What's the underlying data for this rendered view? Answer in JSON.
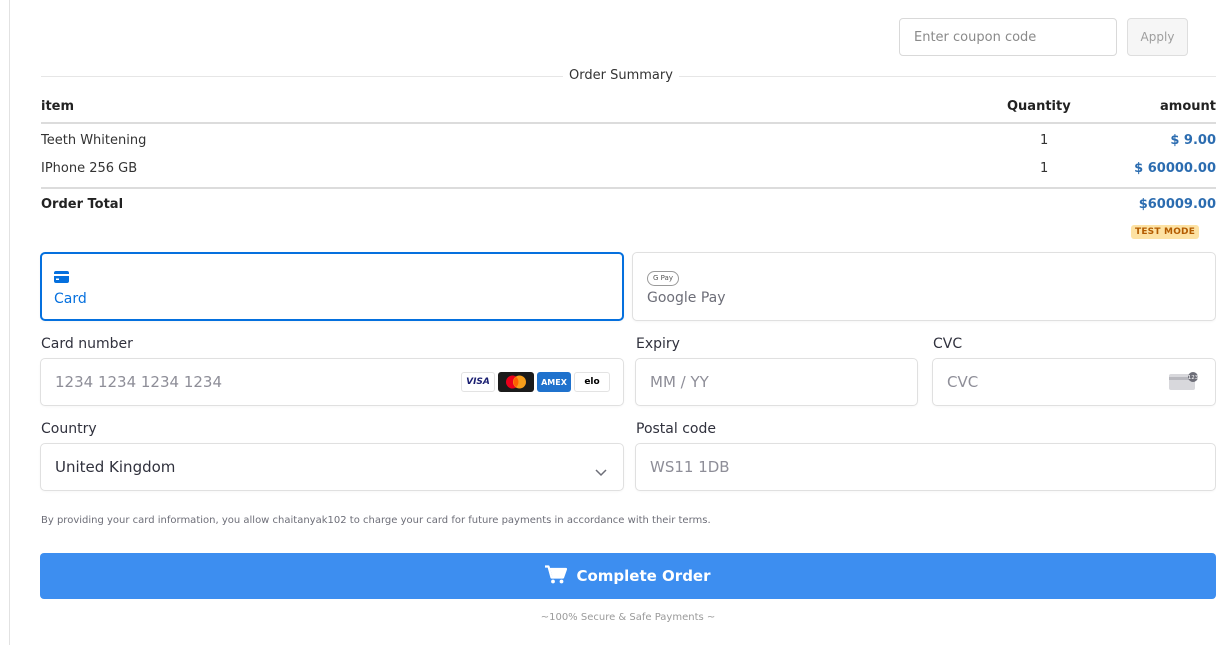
{
  "coupon": {
    "placeholder": "Enter coupon code",
    "apply_label": "Apply"
  },
  "summary": {
    "title": "Order Summary",
    "columns": {
      "item": "item",
      "quantity": "Quantity",
      "amount": "amount"
    },
    "items": [
      {
        "name": "Teeth Whitening",
        "quantity": "1",
        "amount": "$ 9.00"
      },
      {
        "name": "IPhone 256 GB",
        "quantity": "1",
        "amount": "$ 60000.00"
      }
    ],
    "total_label": "Order Total",
    "total_amount": "$60009.00",
    "mode_badge": "TEST MODE"
  },
  "payment": {
    "tabs": [
      {
        "label": "Card",
        "icon": "card-icon",
        "selected": true
      },
      {
        "label": "Google Pay",
        "icon": "google-pay-icon",
        "badge": "G Pay",
        "selected": false
      }
    ],
    "card_number": {
      "label": "Card number",
      "placeholder": "1234 1234 1234 1234",
      "brands": [
        "VISA",
        "Mastercard",
        "AMEX",
        "elo"
      ]
    },
    "expiry": {
      "label": "Expiry",
      "placeholder": "MM / YY"
    },
    "cvc": {
      "label": "CVC",
      "placeholder": "CVC"
    },
    "country": {
      "label": "Country",
      "value": "United Kingdom"
    },
    "postal": {
      "label": "Postal code",
      "placeholder": "WS11 1DB"
    },
    "terms": "By providing your card information, you allow chaitanyak102 to charge your card for future payments in accordance with their terms."
  },
  "submit": {
    "label": "Complete Order"
  },
  "footer": {
    "secure_text": "~100% Secure & Safe Payments ~"
  },
  "colors": {
    "accent": "#0570de",
    "button": "#3d8ef0",
    "amount": "#2b6cb0",
    "badge_bg": "#fde2a3"
  }
}
